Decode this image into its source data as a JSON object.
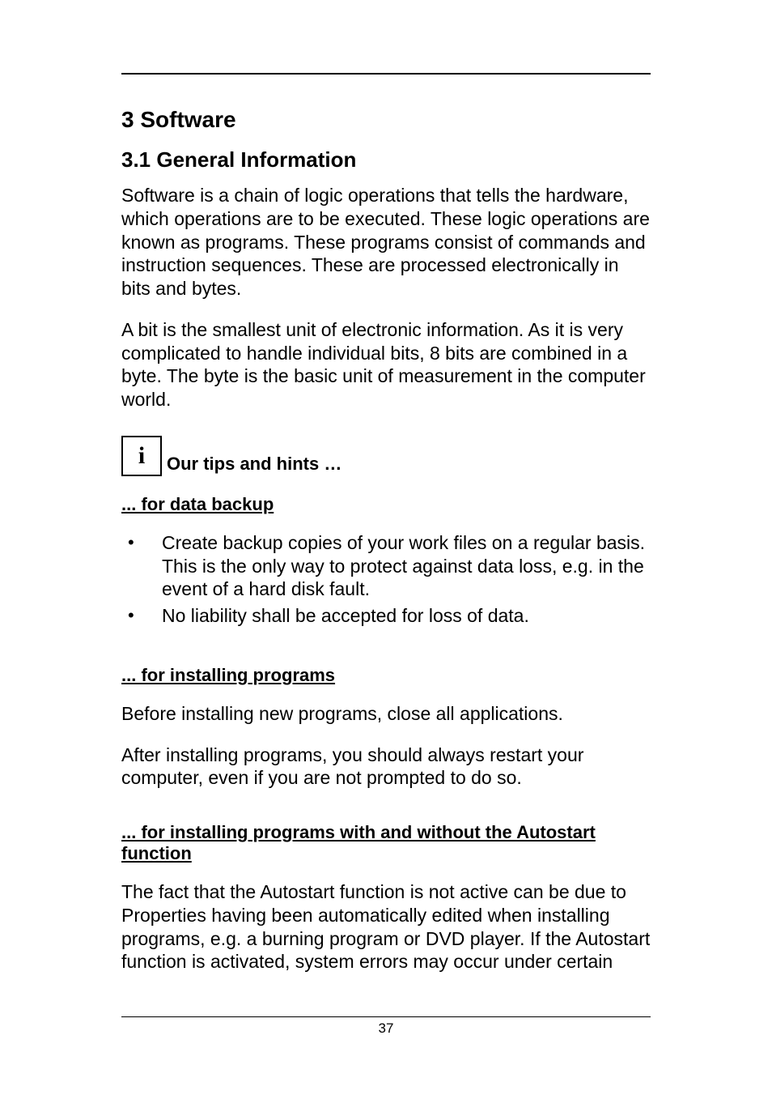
{
  "heading1": "3 Software",
  "heading2": "3.1 General Information",
  "para1": "Software is a chain of logic operations that tells the hardware, which operations are to be executed. These logic operations are known as programs. These programs consist of commands and instruction sequences. These are processed electronically in bits and bytes.",
  "para2": "A bit is the smallest unit of electronic information. As it is very complicated to handle individual bits, 8 bits are combined in a byte. The byte is the basic unit of measurement in the computer world.",
  "info_icon_char": "i",
  "tips_label": " Our tips and hints …",
  "sub_backup": "... for data backup",
  "bullets_backup": [
    "Create backup copies of your work files on a regular basis. This is the only way to protect against data loss, e.g. in the event of a hard disk fault.",
    "No liability shall be accepted for loss of data."
  ],
  "sub_install": "... for installing programs",
  "para_install1": "Before installing new programs, close all applications.",
  "para_install2": "After installing programs, you should always restart your computer, even if you are not prompted to do so.",
  "sub_autostart": "... for installing programs with and without the Autostart function",
  "para_autostart": "The fact that the Autostart function is not active can be due to Properties having been automatically edited when installing programs, e.g. a burning program or DVD player. If the Autostart function is activated, system errors may occur under certain",
  "page_number": "37"
}
